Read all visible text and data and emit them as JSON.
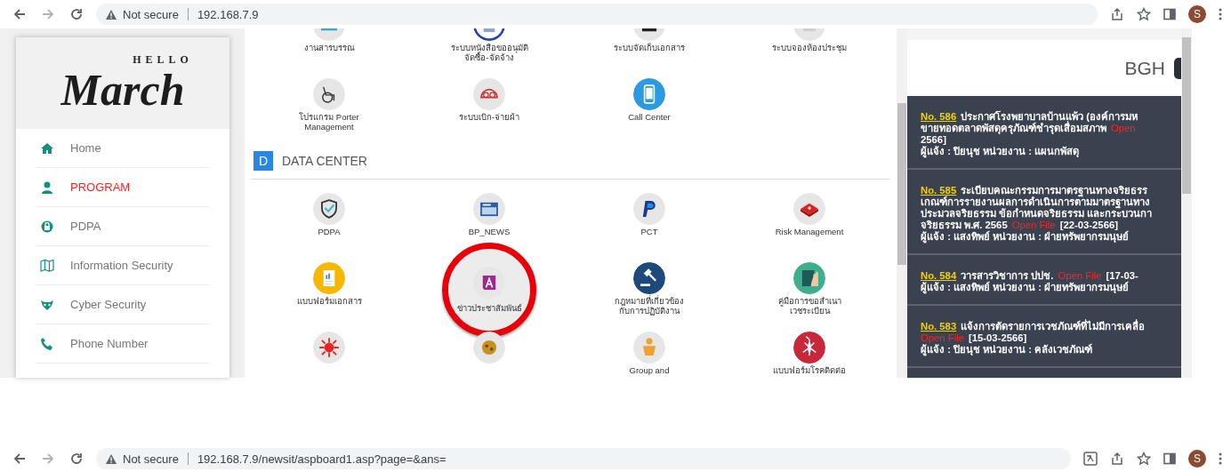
{
  "top_bar": {
    "security": "Not secure",
    "url": "192.168.7.9",
    "avatar": "S",
    "translate": false
  },
  "sidebar": {
    "logo": {
      "small": "HELLO",
      "main": "March"
    },
    "items": [
      {
        "kind": "home",
        "label": "Home",
        "selected": false
      },
      {
        "kind": "user",
        "label": "PROGRAM",
        "selected": true
      },
      {
        "kind": "lock",
        "label": "PDPA",
        "selected": false
      },
      {
        "kind": "map",
        "label": "Information Security",
        "selected": false
      },
      {
        "kind": "mask",
        "label": "Cyber Security",
        "selected": false
      },
      {
        "kind": "phone",
        "label": "Phone Number",
        "selected": false
      }
    ]
  },
  "program_tiles": [
    {
      "kind": "envelope",
      "label": "งานสารบรรณ",
      "selected": false
    },
    {
      "kind": "document",
      "label": "ระบบหนังสือขออนุมัติ\nจัดซื้อ-จัดจ้าง",
      "selected": false
    },
    {
      "kind": "folder",
      "label": "ระบบจัดเก็บเอกสาร",
      "selected": false
    },
    {
      "kind": "keypad",
      "label": "ระบบจองห้องประชุม",
      "selected": false
    },
    {
      "kind": "wheelchair",
      "label": "โปรแกรม Porter\nManagement",
      "selected": false
    },
    {
      "kind": "cloth",
      "label": "ระบบเบิก-จ่ายผ้า",
      "selected": false
    },
    {
      "kind": "mobile",
      "label": "Call Center",
      "selected": false
    }
  ],
  "data_center": {
    "badge": "D",
    "title": "DATA CENTER",
    "tiles": [
      {
        "kind": "shield",
        "label": "PDPA",
        "selected": false
      },
      {
        "kind": "newspaper",
        "label": "BP_NEWS",
        "selected": false
      },
      {
        "kind": "p-letter",
        "label": "PCT",
        "selected": false
      },
      {
        "kind": "first-aid",
        "label": "Risk Management",
        "selected": false
      },
      {
        "kind": "form",
        "label": "แบบฟอร์มเอกสาร",
        "selected": false
      },
      {
        "kind": "a-letter",
        "label": "ข่าวประชาสัมพันธ์",
        "selected": true
      },
      {
        "kind": "gavel",
        "label": "กฎหมายที่เกี่ยวข้อง\nกับการปฏิบัติงาน",
        "selected": false
      },
      {
        "kind": "book",
        "label": "คู่มือการขอสำเนา\nเวชระเบียน",
        "selected": false
      },
      {
        "kind": "virus",
        "selected": false
      },
      {
        "kind": "germ",
        "selected": false
      },
      {
        "kind": "baby",
        "label": "Group and",
        "selected": false
      },
      {
        "kind": "mosquito",
        "label": "แบบฟอร์มโรคติดต่อ",
        "selected": false
      }
    ]
  },
  "notice_panel": {
    "title": "BGH",
    "notices": [
      {
        "lines": [
          [
            {
              "kind": "number",
              "text": "No. 586"
            },
            {
              "kind": "text",
              "text": "ประกาศโรงพยาบาลบ้านแพ้ว (องค์การมห"
            }
          ],
          [
            {
              "kind": "text",
              "text": "ขายทอดตลาดพัสดุครุภัณฑ์ชำรุดเสื่อมสภาพ"
            },
            {
              "kind": "link",
              "text": "Open"
            }
          ],
          [
            {
              "kind": "text",
              "text": "2566]"
            }
          ],
          [
            {
              "kind": "text",
              "text": "ผู้แจ้ง : ปิยนุช หน่วยงาน : แผนกพัสดุ"
            }
          ]
        ]
      },
      {
        "lines": [
          [
            {
              "kind": "number",
              "text": "No. 585"
            },
            {
              "kind": "text",
              "text": "ระเบียบคณะกรรมการมาตรฐานทางจริยธรร"
            }
          ],
          [
            {
              "kind": "text",
              "text": "เกณฑ์การรายงานผลการดำเนินการตามมาตรฐานทาง"
            }
          ],
          [
            {
              "kind": "text",
              "text": "ประมวลจริยธรรม ข้อกำหนดจริยธรรม และกระบวนกา"
            }
          ],
          [
            {
              "kind": "text",
              "text": "จริยธรรม พ.ศ. 2565"
            },
            {
              "kind": "link",
              "text": "Open File"
            },
            {
              "kind": "text",
              "text": "[22-03-2566]"
            }
          ],
          [
            {
              "kind": "text",
              "text": "ผู้แจ้ง : แสงทิพย์ หน่วยงาน : ฝ่ายทรัพยากรมนุษย์"
            }
          ]
        ]
      },
      {
        "lines": [
          [
            {
              "kind": "number",
              "text": "No. 584"
            },
            {
              "kind": "text",
              "text": "วารสารวิชาการ ปปช."
            },
            {
              "kind": "link",
              "text": "Open File"
            },
            {
              "kind": "text",
              "text": "[17-03-"
            }
          ],
          [
            {
              "kind": "text",
              "text": "ผู้แจ้ง : แสงทิพย์ หน่วยงาน : ฝ่ายทรัพยากรมนุษย์"
            }
          ]
        ]
      },
      {
        "lines": [
          [
            {
              "kind": "number",
              "text": "No. 583"
            },
            {
              "kind": "text",
              "text": "แจ้งการตัดรายการเวชภัณฑ์ที่ไม่มีการเคลื่อ"
            }
          ],
          [
            {
              "kind": "link",
              "text": "Open File"
            },
            {
              "kind": "text",
              "text": "[15-03-2566]"
            }
          ],
          [
            {
              "kind": "text",
              "text": "ผู้แจ้ง : ปิยนุช หน่วยงาน : คลังเวชภัณฑ์"
            }
          ]
        ]
      }
    ]
  },
  "bottom_bar": {
    "security": "Not secure",
    "url": "192.168.7.9/newsit/aspboard1.asp?page=&ans=",
    "avatar": "S",
    "translate": true
  }
}
